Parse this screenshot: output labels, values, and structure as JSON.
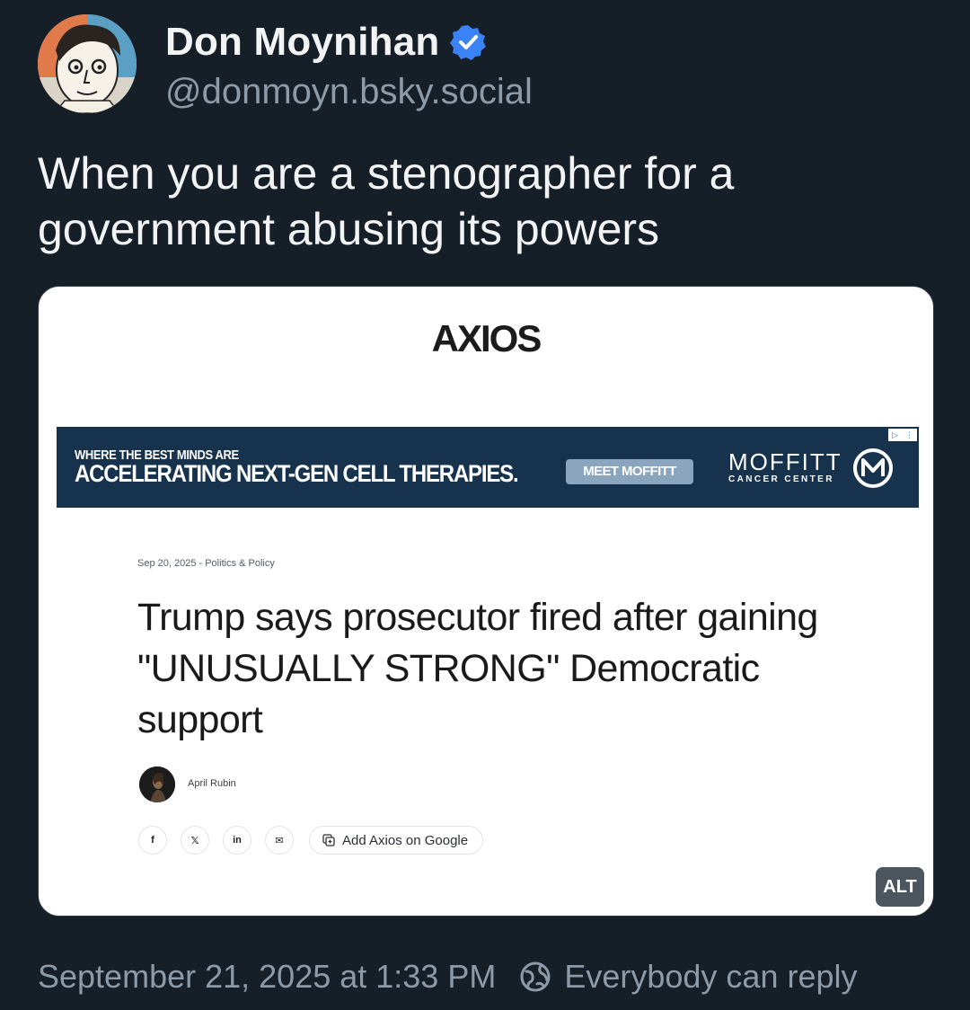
{
  "author": {
    "name": "Don Moynihan",
    "handle": "@donmoyn.bsky.social",
    "verified_color": "#3b82f6"
  },
  "post": {
    "text": "When you are a stenographer for a government abusing its powers"
  },
  "embedded_image": {
    "alt_badge": "ALT",
    "logo_text": "AXIOS",
    "ad": {
      "kicker": "WHERE THE BEST MINDS ARE",
      "headline": "ACCELERATING NEXT-GEN CELL THERAPIES.",
      "cta": "MEET MOFFITT",
      "brand_name": "MOFFITT",
      "brand_sub": "CANCER CENTER"
    },
    "article": {
      "dateline": "Sep 20, 2025 - Politics & Policy",
      "headline": "Trump says prosecutor fired after gaining \"UNUSUALLY STRONG\" Democratic support",
      "author": "April Rubin",
      "share_icons": [
        "facebook-icon",
        "x-icon",
        "linkedin-icon",
        "email-icon"
      ],
      "share_labels": [
        "f",
        "𝕏",
        "in",
        "✉"
      ],
      "add_google_label": "Add Axios on Google"
    }
  },
  "footer": {
    "timestamp": "September 21, 2025 at 1:33 PM",
    "reply_setting": "Everybody can reply"
  }
}
